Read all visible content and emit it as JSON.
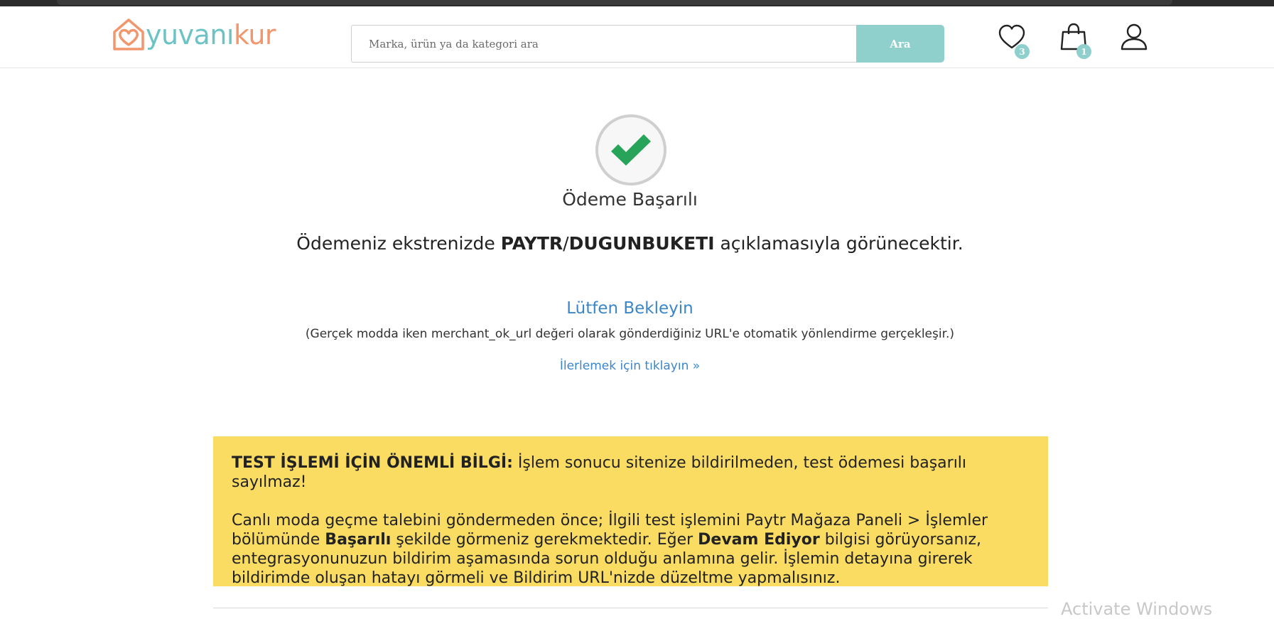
{
  "header": {
    "logo": {
      "text_part1": "yuvanı",
      "text_part2": "kur"
    },
    "search": {
      "placeholder": "Marka, ürün ya da kategori ara",
      "value": "",
      "button_label": "Ara"
    },
    "favorites": {
      "icon": "heart-icon",
      "count": "3"
    },
    "cart": {
      "icon": "shopping-bag-icon",
      "count": "1"
    },
    "account": {
      "icon": "user-icon"
    }
  },
  "main": {
    "status_icon": "checkmark-icon",
    "title": "Ödeme Başarılı",
    "statement": {
      "prefix": "Ödemeniz ekstrenizde ",
      "merchant_1": "PAYTR",
      "separator": "/",
      "merchant_2": "DUGUNBUKETI",
      "suffix": " açıklamasıyla görünecektir."
    },
    "wait_text": "Lütfen Bekleyin",
    "note_text": "(Gerçek modda iken merchant_ok_url değeri olarak gönderdiğiniz URL'e otomatik yönlendirme gerçekleşir.)",
    "proceed_link": "İlerlemek için tıklayın »"
  },
  "info_box": {
    "heading": "TEST İŞLEMİ İÇİN ÖNEMLİ BİLGİ:",
    "heading_text": " İşlem sonucu sitenize bildirilmeden, test ödemesi başarılı sayılmaz!",
    "p2_part1": "Canlı moda geçme talebini göndermeden önce; İlgili test işlemini Paytr Mağaza Paneli > İşlemler bölümünde ",
    "p2_bold1": "Başarılı",
    "p2_part2": " şekilde görmeniz gerekmektedir. Eğer ",
    "p2_bold2": "Devam Ediyor",
    "p2_part3": " bilgisi görüyorsanız, entegrasyonunuzun bildirim aşamasında sorun olduğu anlamına gelir. İşlemin detayına girerek bildirimde oluşan hatayı görmeli ve Bildirim URL'nizde düzeltme yapmalısınız."
  },
  "watermark": "Activate Windows",
  "colors": {
    "brand_teal": "#6cc3c4",
    "brand_orange": "#f2966d",
    "search_button": "#8fcfcc",
    "success_green": "#27a35a",
    "link_blue": "#3a86c8",
    "info_yellow": "#fadc63"
  }
}
